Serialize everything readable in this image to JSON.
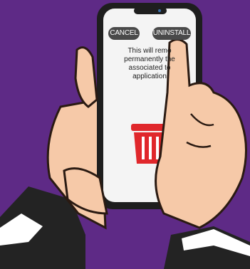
{
  "dialog": {
    "cancel_label": "CANCEL",
    "uninstall_label": "UNINSTALL",
    "message_lines": [
      "This will remo",
      "permanently the",
      "associated to",
      "application"
    ]
  },
  "colors": {
    "background": "#5e2a86",
    "phone_frame": "#1e1e1e",
    "screen": "#f4f4f4",
    "button": "#4a4a4a",
    "trash": "#e0272b",
    "skin": "#f6c9a8",
    "sleeve": "#232323"
  },
  "icons": [
    "trash-can-icon",
    "front-camera-icon"
  ]
}
